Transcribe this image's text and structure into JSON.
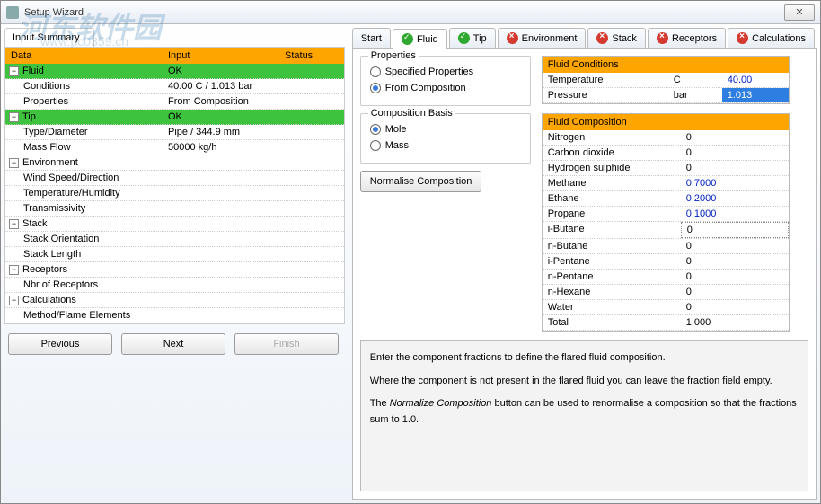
{
  "window": {
    "title": "Setup Wizard"
  },
  "watermark": {
    "line1": "河东软件园",
    "line2": "www.pc0359.cn"
  },
  "leftTab": {
    "label": "Input Summary"
  },
  "summary": {
    "headers": {
      "data": "Data",
      "input": "Input",
      "status": "Status"
    },
    "rows": [
      {
        "kind": "parent",
        "label": "Fluid",
        "input": "OK",
        "ok": true
      },
      {
        "kind": "child",
        "label": "Conditions",
        "input": "40.00 C / 1.013 bar"
      },
      {
        "kind": "child",
        "label": "Properties",
        "input": "From Composition"
      },
      {
        "kind": "parent",
        "label": "Tip",
        "input": "OK",
        "ok": true
      },
      {
        "kind": "child",
        "label": "Type/Diameter",
        "input": "Pipe / 344.9 mm"
      },
      {
        "kind": "child",
        "label": "Mass Flow",
        "input": "50000 kg/h"
      },
      {
        "kind": "parent",
        "label": "Environment",
        "input": ""
      },
      {
        "kind": "child",
        "label": "Wind Speed/Direction",
        "input": ""
      },
      {
        "kind": "child",
        "label": "Temperature/Humidity",
        "input": ""
      },
      {
        "kind": "child",
        "label": "Transmissivity",
        "input": ""
      },
      {
        "kind": "parent",
        "label": "Stack",
        "input": ""
      },
      {
        "kind": "child",
        "label": "Stack Orientation",
        "input": ""
      },
      {
        "kind": "child",
        "label": "Stack Length",
        "input": ""
      },
      {
        "kind": "parent",
        "label": "Receptors",
        "input": ""
      },
      {
        "kind": "child",
        "label": "Nbr of Receptors",
        "input": ""
      },
      {
        "kind": "parent",
        "label": "Calculations",
        "input": ""
      },
      {
        "kind": "child",
        "label": "Method/Flame Elements",
        "input": ""
      }
    ]
  },
  "nav": {
    "prev": "Previous",
    "next": "Next",
    "finish": "Finish"
  },
  "tabs": [
    {
      "label": "Start",
      "status": "none"
    },
    {
      "label": "Fluid",
      "status": "ok",
      "active": true
    },
    {
      "label": "Tip",
      "status": "ok"
    },
    {
      "label": "Environment",
      "status": "err"
    },
    {
      "label": "Stack",
      "status": "err"
    },
    {
      "label": "Receptors",
      "status": "err"
    },
    {
      "label": "Calculations",
      "status": "err"
    }
  ],
  "properties": {
    "legend": "Properties",
    "opt1": "Specified Properties",
    "opt2": "From Composition"
  },
  "basis": {
    "legend": "Composition Basis",
    "opt1": "Mole",
    "opt2": "Mass"
  },
  "normalize": "Normalise Composition",
  "conditions": {
    "header": "Fluid Conditions",
    "rows": [
      {
        "label": "Temperature",
        "unit": "C",
        "value": "40.00"
      },
      {
        "label": "Pressure",
        "unit": "bar",
        "value": "1.013",
        "selected": true
      }
    ]
  },
  "composition": {
    "header": "Fluid Composition",
    "rows": [
      {
        "label": "Nitrogen",
        "value": "0"
      },
      {
        "label": "Carbon dioxide",
        "value": "0"
      },
      {
        "label": "Hydrogen sulphide",
        "value": "0"
      },
      {
        "label": "Methane",
        "value": "0.7000",
        "blue": true
      },
      {
        "label": "Ethane",
        "value": "0.2000",
        "blue": true
      },
      {
        "label": "Propane",
        "value": "0.1000",
        "blue": true
      },
      {
        "label": "i-Butane",
        "value": "0",
        "dotted": true
      },
      {
        "label": "n-Butane",
        "value": "0"
      },
      {
        "label": "i-Pentane",
        "value": "0"
      },
      {
        "label": "n-Pentane",
        "value": "0"
      },
      {
        "label": "n-Hexane",
        "value": "0"
      },
      {
        "label": "Water",
        "value": "0"
      },
      {
        "label": "Total",
        "value": "1.000"
      }
    ]
  },
  "help": {
    "p1": "Enter the component fractions to define the flared fluid composition.",
    "p2": "Where the component is not present in the flared fluid you can leave the fraction field empty.",
    "p3a": "The ",
    "p3i": "Normalize Composition",
    "p3b": " button can be used to renormalise a composition so that the fractions sum to 1.0."
  }
}
